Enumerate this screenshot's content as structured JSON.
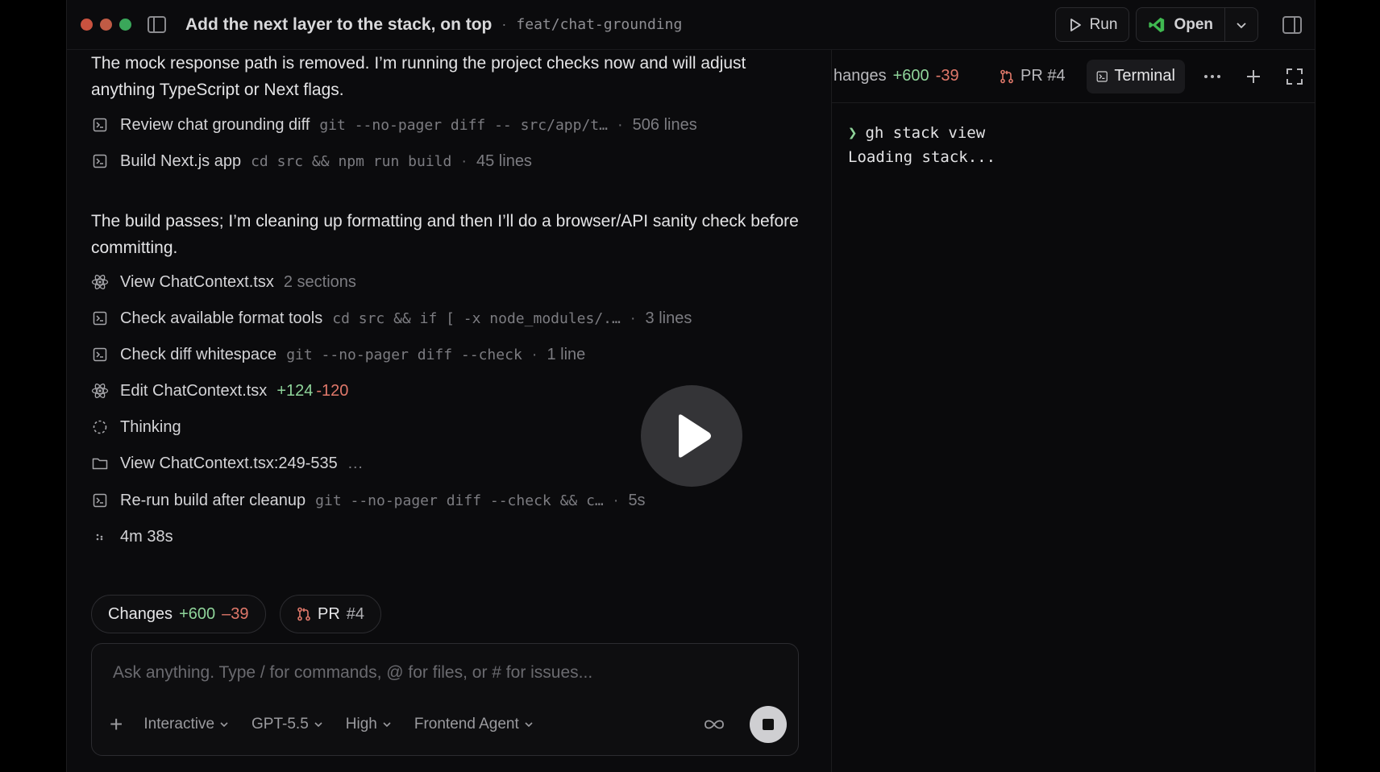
{
  "titlebar": {
    "title": "Add the next layer to the stack, on top",
    "separator": "·",
    "branch": "feat/chat-grounding",
    "run_label": "Run",
    "open_label": "Open"
  },
  "chat": {
    "paragraph1": "The mock response path is removed. I’m running the project checks now and will adjust anything TypeScript or Next flags.",
    "paragraph2": "The build passes; I’m cleaning up formatting and then I’ll do a browser/API sanity check before committing.",
    "steps": [
      {
        "icon": "terminal-icon",
        "label": "Review chat grounding diff",
        "cmd": "git --no-pager diff -- src/app/t…",
        "meta": "506 lines"
      },
      {
        "icon": "terminal-icon",
        "label": "Build Next.js app",
        "cmd": "cd src && npm run build",
        "meta": "45 lines"
      },
      {
        "icon": "react-icon",
        "label": "View ChatContext.tsx",
        "meta": "2 sections"
      },
      {
        "icon": "terminal-icon",
        "label": "Check available format tools",
        "cmd": "cd src && if [ -x node_modules/.…",
        "meta": "3 lines"
      },
      {
        "icon": "terminal-icon",
        "label": "Check diff whitespace",
        "cmd": "git --no-pager diff --check",
        "meta": "1 line"
      },
      {
        "icon": "react-icon",
        "label": "Edit ChatContext.tsx",
        "added": "+124",
        "removed": "-120"
      },
      {
        "icon": "spinner-icon",
        "label": "Thinking"
      },
      {
        "icon": "folder-icon",
        "label": "View ChatContext.tsx:249-535",
        "meta": "…"
      },
      {
        "icon": "terminal-icon",
        "label": "Re-run build after cleanup",
        "cmd": "git --no-pager diff --check && c…",
        "meta": "5s"
      },
      {
        "icon": "dots-icon",
        "label": "4m 38s"
      }
    ],
    "dot": "·"
  },
  "chips": {
    "changes_label": "Changes",
    "changes_added": "+600",
    "changes_removed": "–39",
    "pr_label": "PR",
    "pr_number": "#4"
  },
  "composer": {
    "placeholder": "Ask anything. Type / for commands, @ for files, or # for issues...",
    "mode": "Interactive",
    "model": "GPT-5.5",
    "effort": "High",
    "agent": "Frontend Agent"
  },
  "right_panel": {
    "tabs": {
      "changes_label": "hanges",
      "changes_added": "+600",
      "changes_removed": "-39",
      "pr_label": "PR #4",
      "terminal_label": "Terminal"
    },
    "terminal": {
      "prompt": "❯",
      "command": "gh stack view",
      "output": "Loading stack..."
    }
  },
  "colors": {
    "added": "#8fd49a",
    "removed": "#e0786a",
    "background": "#0b0b0d"
  }
}
